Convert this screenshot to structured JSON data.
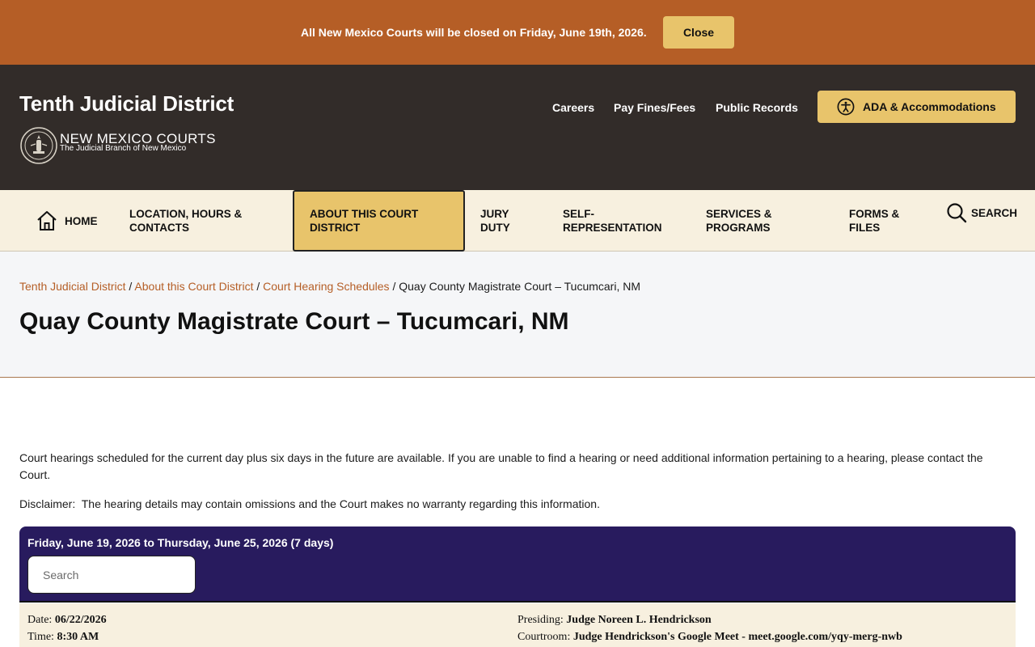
{
  "alert": {
    "message": "All New Mexico Courts will be closed on Friday, June 19th, 2026.",
    "close_label": "Close"
  },
  "header": {
    "site_title": "Tenth Judicial District",
    "logo_title": "NEW MEXICO COURTS",
    "logo_subtitle": "The Judicial Branch of New Mexico",
    "utility_links": [
      "Careers",
      "Pay Fines/Fees",
      "Public Records"
    ],
    "ada_label": "ADA & Accommodations"
  },
  "nav": {
    "home": "HOME",
    "location": "LOCATION, HOURS & CONTACTS",
    "about": "ABOUT THIS COURT DISTRICT",
    "jury": "JURY DUTY",
    "self_rep": "SELF-REPRESENTATION",
    "services": "SERVICES & PROGRAMS",
    "forms": "FORMS & FILES",
    "search": "SEARCH"
  },
  "breadcrumb": {
    "items": [
      "Tenth Judicial District",
      "About this Court District",
      "Court Hearing Schedules"
    ],
    "separator": "/",
    "current": "Quay County Magistrate Court – Tucumcari, NM"
  },
  "page": {
    "title": "Quay County Magistrate Court – Tucumcari, NM",
    "intro": "Court hearings scheduled for the current day plus six days in the future are available. If you are unable to find a hearing or need additional information pertaining to a hearing, please contact the Court.",
    "disclaimer": "Disclaimer:  The hearing details may contain omissions and the Court makes no warranty regarding this information."
  },
  "schedule": {
    "range": "Friday, June 19, 2026 to Thursday, June 25, 2026 (7 days)",
    "search_placeholder": "Search",
    "hearings": [
      {
        "date_label": "Date:",
        "date": "06/22/2026",
        "time_label": "Time:",
        "time": "8:30 AM",
        "presiding_label": "Presiding:",
        "presiding": "Judge Noreen L. Hendrickson",
        "courtroom_label": "Courtroom:",
        "courtroom": "Judge Hendrickson's Google Meet - meet.google.com/yqy-merg-nwb"
      }
    ]
  },
  "colors": {
    "alert_bg": "#b55e26",
    "header_bg": "#322c29",
    "accent_gold": "#e8c46b",
    "nav_bg": "#f7f0df",
    "schedule_bg": "#281b5e",
    "link": "#b55e26"
  }
}
